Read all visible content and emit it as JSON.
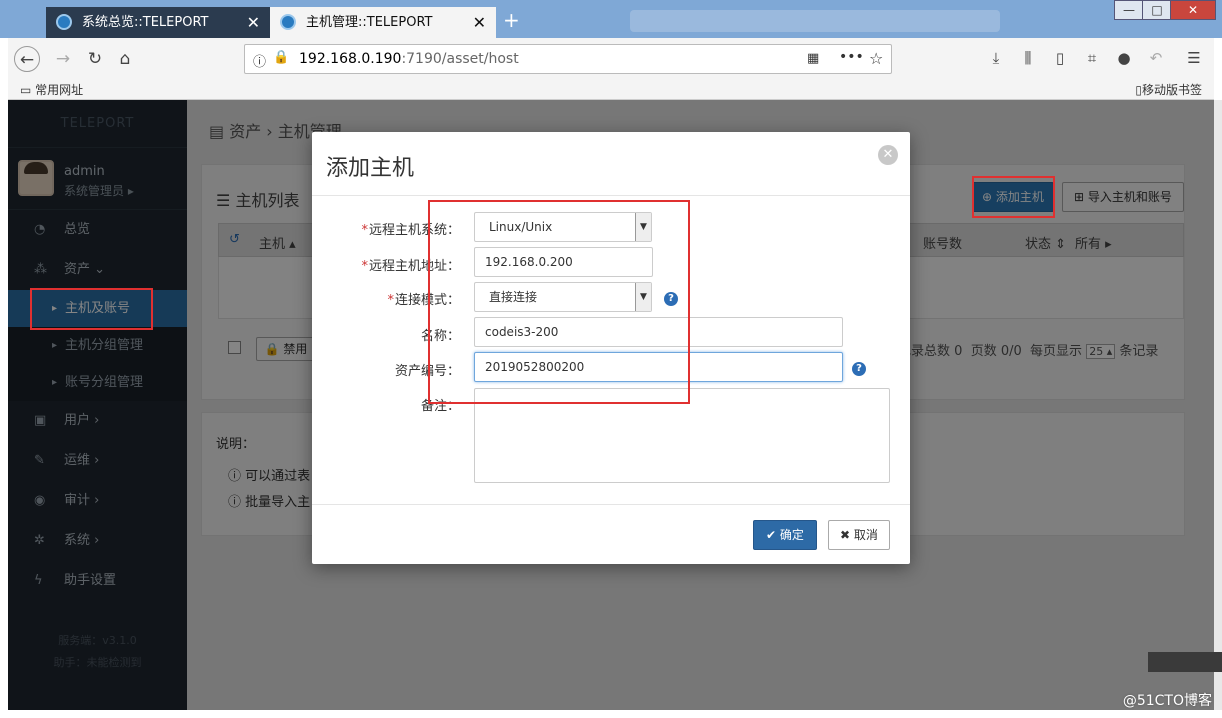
{
  "browser": {
    "tabs": [
      {
        "label": "系统总览::TELEPORT",
        "active": false
      },
      {
        "label": "主机管理::TELEPORT",
        "active": true
      }
    ],
    "new_tab": "+",
    "url_host": "192.168.0.190",
    "url_rest": ":7190/asset/host",
    "bookmarks_left": "常用网址",
    "bookmarks_right": "移动版书签"
  },
  "sidebar": {
    "logo": "TELEPORT",
    "user_name": "admin",
    "user_role": "系统管理员",
    "items": [
      {
        "label": "总览",
        "icon": "dashboard-icon"
      },
      {
        "label": "资产",
        "icon": "cubes-icon"
      }
    ],
    "sub_items": [
      "主机及账号",
      "主机分组管理",
      "账号分组管理"
    ],
    "items2": [
      {
        "label": "用户",
        "icon": "user-icon"
      },
      {
        "label": "运维",
        "icon": "wrench-icon"
      },
      {
        "label": "审计",
        "icon": "eye-icon"
      },
      {
        "label": "系统",
        "icon": "cog-icon"
      },
      {
        "label": "助手设置",
        "icon": "bolt-icon"
      }
    ],
    "server_version": "服务端：v3.1.0",
    "assistant_status": "助手：未能检测到"
  },
  "main": {
    "breadcrumb_1": "资产",
    "breadcrumb_2": "主机管理",
    "panel_title": "主机列表",
    "add_host_button": "添加主机",
    "import_button": "导入主机和账号",
    "table_headers": {
      "host": "主机",
      "accounts": "账号数",
      "status": "状态",
      "all": "所有"
    },
    "disable_button": "禁用",
    "pagination": {
      "total_label": "记录总数",
      "total": "0",
      "pages_label": "页数",
      "pages": "0/0",
      "per_page_label": "每页显示",
      "per_page": "25",
      "records_label": "条记录"
    },
    "notes_title": "说明：",
    "note1": "可以通过表",
    "note2": "批量导入主"
  },
  "modal": {
    "title": "添加主机",
    "fields": {
      "os_label": "远程主机系统：",
      "os_value": "Linux/Unix",
      "ip_label": "远程主机地址：",
      "ip_value": "192.168.0.200",
      "mode_label": "连接模式：",
      "mode_value": "直接连接",
      "name_label": "名称：",
      "name_value": "codeis3-200",
      "asset_label": "资产编号：",
      "asset_value": "2019052800200",
      "remark_label": "备注：",
      "remark_value": ""
    },
    "ok_button": "确定",
    "cancel_button": "取消"
  },
  "watermark": "@51CTO博客"
}
